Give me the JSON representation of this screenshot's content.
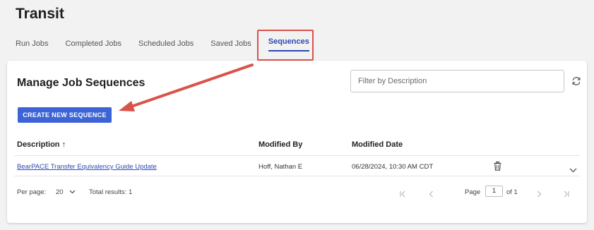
{
  "app": {
    "title": "Transit"
  },
  "tabs": [
    {
      "label": "Run Jobs",
      "active": false
    },
    {
      "label": "Completed Jobs",
      "active": false
    },
    {
      "label": "Scheduled Jobs",
      "active": false
    },
    {
      "label": "Saved Jobs",
      "active": false
    },
    {
      "label": "Sequences",
      "active": true
    }
  ],
  "card": {
    "title": "Manage Job Sequences",
    "filter_placeholder": "Filter by Description",
    "refresh_icon": "refresh-icon",
    "create_button": "CREATE NEW SEQUENCE"
  },
  "table": {
    "columns": [
      "Description ↑",
      "Modified By",
      "Modified Date"
    ],
    "rows": [
      {
        "description": "BearPACE Transfer Equivalency Guide Update",
        "modified_by": "Hoff, Nathan E",
        "modified_date": "06/28/2024, 10:30 AM CDT"
      }
    ]
  },
  "pagination": {
    "per_page_label": "Per page:",
    "per_page_value": "20",
    "total_label": "Total results: 1",
    "page_label": "Page",
    "page_value": "1",
    "of_label": "of 1"
  },
  "annotation": {
    "color": "#d9534a"
  },
  "colors": {
    "accent": "#3d64d6",
    "link": "#2c4ab0"
  }
}
